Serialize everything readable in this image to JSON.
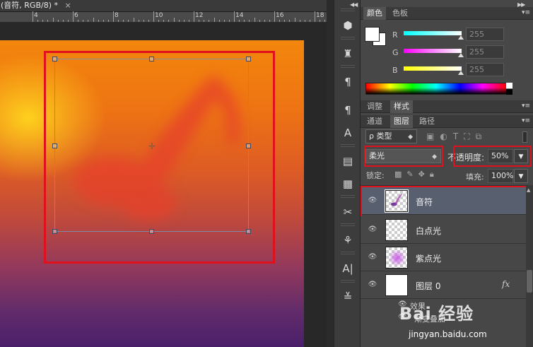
{
  "document": {
    "tab_title": "(音符, RGB/8) *",
    "close_glyph": "×",
    "ruler_numbers": [
      "4",
      "6",
      "8",
      "10",
      "12",
      "14",
      "16",
      "18"
    ]
  },
  "toolstrip": {
    "collapse_glyph": "◀◀",
    "tools": [
      {
        "icon": "3d-cube-icon",
        "glyph": "⬢"
      },
      {
        "icon": "stamp-icon",
        "glyph": "♜"
      },
      {
        "icon": "paragraph-icon",
        "glyph": "¶"
      },
      {
        "icon": "paragraph-styles-icon",
        "glyph": "¶"
      },
      {
        "icon": "character-styles-icon",
        "glyph": "A"
      },
      {
        "icon": "properties-icon",
        "glyph": "▤"
      },
      {
        "icon": "notes-icon",
        "glyph": "▦"
      },
      {
        "icon": "tools-crossed-icon",
        "glyph": "✂"
      },
      {
        "icon": "brush-presets-icon",
        "glyph": "⚘"
      },
      {
        "icon": "type-icon",
        "glyph": "A|"
      },
      {
        "icon": "adjustments-icon",
        "glyph": "≚"
      }
    ]
  },
  "panels": {
    "collapse_glyph": "▶▶",
    "color_tabs": [
      "颜色",
      "色板"
    ],
    "color": {
      "foreground": "#ffffff",
      "background": "#ffffff",
      "channels": [
        {
          "label": "R",
          "value": "255",
          "bar_from": "#00ffff",
          "bar_to": "#ffffff"
        },
        {
          "label": "G",
          "value": "255",
          "bar_from": "#ff00ff",
          "bar_to": "#ffffff"
        },
        {
          "label": "B",
          "value": "255",
          "bar_from": "#ffff00",
          "bar_to": "#ffffff"
        }
      ]
    },
    "adjust_tabs": [
      "调整",
      "样式"
    ],
    "layer_tabs": [
      "通道",
      "图层",
      "路径"
    ],
    "filter_label": "ρ 类型",
    "blend_mode": "柔光",
    "opacity_label_prefix": "不",
    "opacity_label": "透明度:",
    "opacity_value": "50%",
    "lock_label": "锁定:",
    "fill_label": "填充:",
    "fill_value": "100%",
    "layers": [
      {
        "name": "音符",
        "selected": true,
        "thumb": "checker"
      },
      {
        "name": "白点光",
        "selected": false,
        "thumb": "checker"
      },
      {
        "name": "紫点光",
        "selected": false,
        "thumb": "checker"
      },
      {
        "name": "图层 0",
        "selected": false,
        "thumb": "white",
        "fx": "fx"
      }
    ],
    "effects_label": "效果",
    "gradient_overlay_label": "渐变叠加"
  },
  "watermark": {
    "main": "Bai 经验",
    "sub": "jingyan.baidu.com"
  },
  "colors": {
    "highlight_red": "#e0101c",
    "selected_layer": "#586070",
    "panel_bg": "#474747"
  }
}
